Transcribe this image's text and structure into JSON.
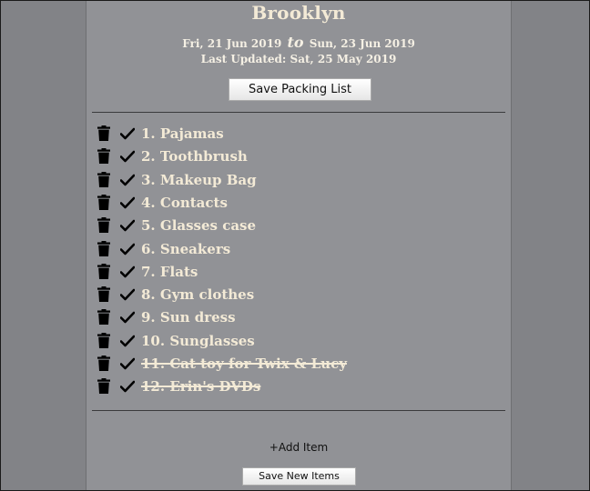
{
  "trip": {
    "city": "Brooklyn",
    "start_date": "Fri, 21 Jun 2019",
    "to_word": "to",
    "end_date": "Sun, 23 Jun 2019",
    "last_updated": "Last Updated: Sat, 25 May 2019"
  },
  "buttons": {
    "save_packing_list": "Save Packing List",
    "add_item": "+Add Item",
    "save_new_items": "Save New Items"
  },
  "items": [
    {
      "label": "1. Pajamas",
      "packed": false
    },
    {
      "label": "2. Toothbrush",
      "packed": false
    },
    {
      "label": "3. Makeup Bag",
      "packed": false
    },
    {
      "label": "4. Contacts",
      "packed": false
    },
    {
      "label": "5. Glasses case",
      "packed": false
    },
    {
      "label": "6. Sneakers",
      "packed": false
    },
    {
      "label": "7. Flats",
      "packed": false
    },
    {
      "label": "8. Gym clothes",
      "packed": false
    },
    {
      "label": "9. Sun dress",
      "packed": false
    },
    {
      "label": "10. Sunglasses",
      "packed": false
    },
    {
      "label": "11. Cat toy for Twix & Lucy",
      "packed": true
    },
    {
      "label": "12. Erin's DVDs",
      "packed": true
    }
  ],
  "icons": {
    "delete": "trash-icon",
    "pack": "checkmark-icon"
  },
  "colors": {
    "text": "#f3ead6",
    "panel": "#919296",
    "background": "#7f8084"
  }
}
